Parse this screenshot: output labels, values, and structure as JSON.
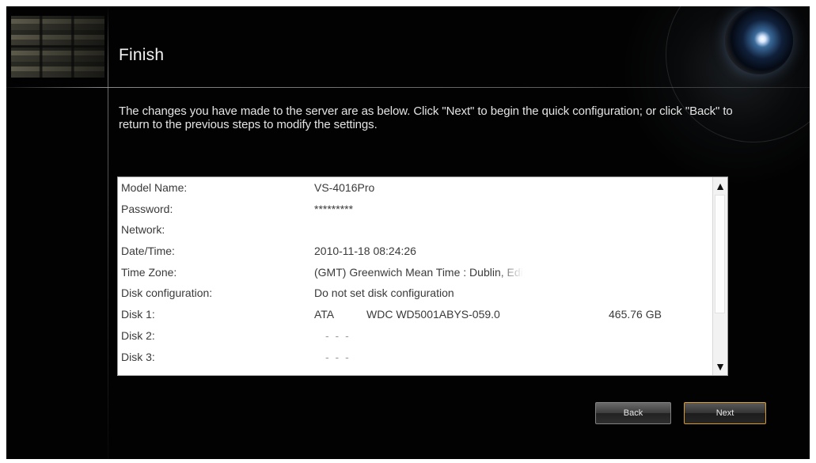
{
  "wizard": {
    "title": "Finish",
    "description": "The changes you have made to the server are as below. Click \"Next\" to begin the quick configuration; or click \"Back\" to return to the previous steps to modify the settings."
  },
  "summary": {
    "rows": [
      {
        "label": "Model Name:",
        "value": "VS-4016Pro"
      },
      {
        "label": "Password:",
        "value": "*********"
      },
      {
        "label": "Network:",
        "value": ""
      },
      {
        "label": "Date/Time:",
        "value": "2010-11-18 08:24:26"
      },
      {
        "label": "Time Zone:",
        "value": "(GMT) Greenwich Mean Time : Dublin, Edi"
      },
      {
        "label": "Disk configuration:",
        "value": "Do not set disk configuration"
      },
      {
        "label": "Disk 1:",
        "value": "ATA",
        "model": "WDC WD5001ABYS-059.0",
        "size": "465.76 GB"
      },
      {
        "label": "Disk 2:",
        "value": "- - -"
      },
      {
        "label": "Disk 3:",
        "value": "- - -"
      }
    ]
  },
  "scrollbar": {
    "up_glyph": "▲",
    "down_glyph": "▼"
  },
  "buttons": {
    "back": "Back",
    "next": "Next"
  },
  "colors": {
    "background": "#020202",
    "next_border": "#d49a3c"
  }
}
